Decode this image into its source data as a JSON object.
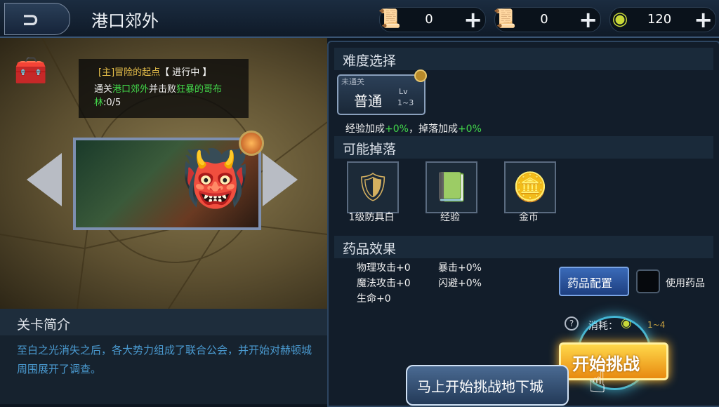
{
  "header": {
    "back_icon": "back-arrow-icon",
    "title": "港口郊外",
    "currencies": [
      {
        "icon": "scroll-lock-icon",
        "value": "0",
        "plus": "+"
      },
      {
        "icon": "scroll-icon",
        "value": "0",
        "plus": "+"
      },
      {
        "icon": "coin-icon",
        "value": "120",
        "plus": "+"
      }
    ]
  },
  "quest": {
    "tag": "[主]",
    "name": "冒险的起点",
    "status": "【 进行中 】",
    "desc_prefix": "通关",
    "desc_place": "港口郊外",
    "desc_mid": "并击败",
    "desc_enemy": "狂暴的哥布林",
    "desc_progress": ":0/5"
  },
  "intro": {
    "title": "关卡简介",
    "text": "至白之光消失之后，各大势力组成了联合公会，并开始对赫顿城周围展开了调查。"
  },
  "difficulty": {
    "section_title": "难度选择",
    "tag": "未通关",
    "name": "普通",
    "lv_label": "Lv",
    "lv_range": "1~3",
    "bonus_prefix": "经验加成",
    "bonus_exp": "+0%",
    "bonus_mid": "，掉落加成",
    "bonus_drop": "+0%"
  },
  "drops": {
    "section_title": "可能掉落",
    "items": [
      {
        "icon": "armor-icon",
        "name": "1级防具白"
      },
      {
        "icon": "exp-book-icon",
        "name": "经验"
      },
      {
        "icon": "gold-coin-icon",
        "name": "金币"
      }
    ]
  },
  "potion": {
    "section_title": "药品效果",
    "stats": [
      "物理攻击+0",
      "魔法攻击+0",
      "生命+0",
      "暴击+0%",
      "闪避+0%"
    ],
    "config_button": "药品配置",
    "use_label": "使用药品"
  },
  "challenge": {
    "help": "?",
    "cost_label": "消耗：",
    "cost_range": "1~4",
    "start_button": "开始挑战",
    "tooltip": "马上开始挑战地下城"
  },
  "colors": {
    "accent_gold": "#e8c04a",
    "accent_green": "#42d84a",
    "intro_text": "#4a9ad0",
    "button_orange": "#e88a10"
  }
}
